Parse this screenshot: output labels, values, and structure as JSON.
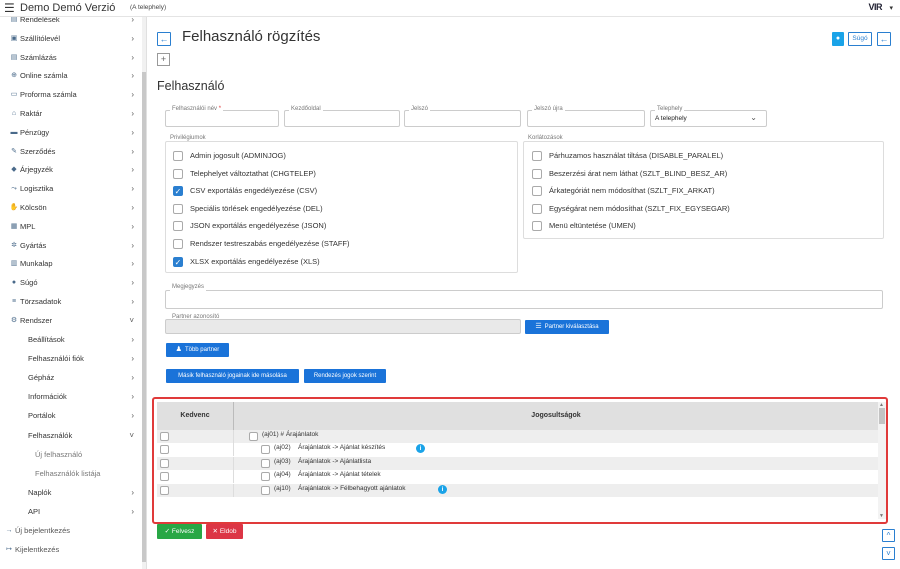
{
  "topbar": {
    "menu_icon": "menu-icon",
    "app_title": "Demo Demó Verzió",
    "app_subtitle": "(A telephely)",
    "logo_text": "VIR",
    "logo_caret": "▾"
  },
  "sidebar": {
    "items": [
      {
        "label": "Rendelések",
        "icon": "list-icon",
        "chevron": "›"
      },
      {
        "label": "Szállítólevél",
        "icon": "truck-icon",
        "chevron": "›"
      },
      {
        "label": "Számlázás",
        "icon": "file-icon",
        "chevron": "›"
      },
      {
        "label": "Online számla",
        "icon": "globe-icon",
        "chevron": "›"
      },
      {
        "label": "Proforma számla",
        "icon": "document-icon",
        "chevron": "›"
      },
      {
        "label": "Raktár",
        "icon": "warehouse-icon",
        "chevron": "›"
      },
      {
        "label": "Pénzügy",
        "icon": "money-icon",
        "chevron": "›"
      },
      {
        "label": "Szerződés",
        "icon": "contract-icon",
        "chevron": "›"
      },
      {
        "label": "Árjegyzék",
        "icon": "tag-icon",
        "chevron": "›"
      },
      {
        "label": "Logisztika",
        "icon": "route-icon",
        "chevron": "›"
      },
      {
        "label": "Kölcsön",
        "icon": "hand-icon",
        "chevron": "›"
      },
      {
        "label": "MPL",
        "icon": "mpl-icon",
        "chevron": "›"
      },
      {
        "label": "Gyártás",
        "icon": "cogs-icon",
        "chevron": "›"
      },
      {
        "label": "Munkalap",
        "icon": "clipboard-icon",
        "chevron": "›"
      },
      {
        "label": "Súgó",
        "icon": "question-icon",
        "chevron": "›"
      },
      {
        "label": "Törzsadatok",
        "icon": "database-icon",
        "chevron": "›"
      },
      {
        "label": "Rendszer",
        "icon": "system-icon",
        "chevron": "˅"
      }
    ],
    "sub_items": [
      {
        "label": "Beállítások",
        "chevron": "›"
      },
      {
        "label": "Felhasználói fiók",
        "chevron": "›"
      },
      {
        "label": "Gépház",
        "chevron": "›"
      },
      {
        "label": "Információk",
        "chevron": "›"
      },
      {
        "label": "Portálok",
        "chevron": "›"
      },
      {
        "label": "Felhasználók",
        "chevron": "˅"
      }
    ],
    "sub_sub_items": [
      {
        "label": "Új felhasználó"
      },
      {
        "label": "Felhasználók listája"
      }
    ],
    "after_items": [
      {
        "label": "Naplók",
        "chevron": "›"
      },
      {
        "label": "API",
        "chevron": "›"
      }
    ],
    "bottom_items": [
      {
        "label": "Új bejelentkezés",
        "icon": "login-icon"
      },
      {
        "label": "Kijelentkezés",
        "icon": "logout-icon"
      }
    ]
  },
  "page": {
    "back_glyph": "←",
    "title": "Felhasználó rögzítés",
    "help_label": "Súgó",
    "plus_glyph": "+",
    "section_title": "Felhasználó"
  },
  "fields": {
    "username_label": "Felhasználói név",
    "username_required": "*",
    "homepage_label": "Kezdőoldal",
    "password_label": "Jelszó",
    "password_again_label": "Jelszó újra",
    "site_label": "Telephely",
    "site_value": "A telephely",
    "note_label": "Megjegyzés",
    "partner_id_label": "Partner azonosító"
  },
  "privileges": {
    "title": "Privilégiumok",
    "items": [
      {
        "label": "Admin jogosult (ADMINJOG)",
        "checked": false
      },
      {
        "label": "Telephelyet változtathat (CHGTELEP)",
        "checked": false
      },
      {
        "label": "CSV exportálás engedélyezése (CSV)",
        "checked": true
      },
      {
        "label": "Speciális törlések engedélyezése (DEL)",
        "checked": false
      },
      {
        "label": "JSON exportálás engedélyezése (JSON)",
        "checked": false
      },
      {
        "label": "Rendszer testreszabás engedélyezése (STAFF)",
        "checked": false
      },
      {
        "label": "XLSX exportálás engedélyezése (XLS)",
        "checked": true
      }
    ]
  },
  "restrictions": {
    "title": "Korlátozások",
    "items": [
      {
        "label": "Párhuzamos használat tiltása (DISABLE_PARALEL)",
        "checked": false
      },
      {
        "label": "Beszerzési árat nem láthat (SZLT_BLIND_BESZ_AR)",
        "checked": false
      },
      {
        "label": "Árkategóriát nem módosíthat (SZLT_FIX_ARKAT)",
        "checked": false
      },
      {
        "label": "Egységárat nem módosíthat (SZLT_FIX_EGYSEGAR)",
        "checked": false
      },
      {
        "label": "Menü eltüntetése (UMEN)",
        "checked": false
      }
    ]
  },
  "buttons": {
    "partner_select": "Partner kiválasztása",
    "more_partner": "Több partner",
    "copy_permissions": "Másik felhasználó jogainak ide másolása",
    "sort_permissions": "Rendezés jogok szerint",
    "save": "Felvesz",
    "cancel": "Eldob",
    "check_glyph": "✓",
    "x_glyph": "✕",
    "scroll_up": "^",
    "scroll_down": "˅"
  },
  "permissions_table": {
    "col_favorite": "Kedvenc",
    "col_permissions": "Jogosultságok",
    "info_glyph": "i",
    "rows": [
      {
        "code": "(aj01) # Árajánlatok",
        "name": "",
        "level": 0,
        "info": false
      },
      {
        "code": "(aj02)",
        "name": "Árajánlatok -> Ajánlat készítés",
        "level": 1,
        "info": true
      },
      {
        "code": "(aj03)",
        "name": "Árajánlatok -> Ajánlatlista",
        "level": 1,
        "info": false
      },
      {
        "code": "(aj04)",
        "name": "Árajánlatok -> Ajánlat tételek",
        "level": 1,
        "info": false
      },
      {
        "code": "(aj10)",
        "name": "Árajánlatok -> Félbehagyott ajánlatok",
        "level": 1,
        "info": true
      }
    ]
  }
}
